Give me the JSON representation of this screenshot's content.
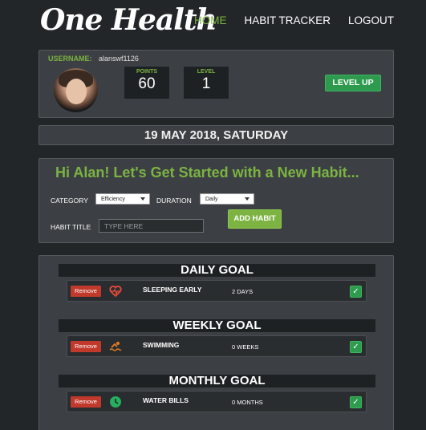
{
  "header": {
    "logo": "One Health",
    "nav": [
      {
        "label": "HOME",
        "active": true
      },
      {
        "label": "HABIT TRACKER",
        "active": false
      },
      {
        "label": "LOGOUT",
        "active": false
      }
    ]
  },
  "profile": {
    "username_label": "USERNAME:",
    "username": "alanswf1126",
    "points_label": "POINTS",
    "points": "60",
    "level_label": "LEVEL",
    "level": "1",
    "level_up_label": "LEVEL UP"
  },
  "date": "19 MAY 2018, SATURDAY",
  "new_habit": {
    "title": "Hi Alan! Let's Get Started with a New Habit...",
    "category_label": "CATEGORY",
    "category_value": "Efficiency",
    "duration_label": "DURATION",
    "duration_value": "Daily",
    "habit_title_label": "HABIT TITLE",
    "habit_title_placeholder": "TYPE HERE",
    "add_button": "ADD HABIT"
  },
  "goals": [
    {
      "heading": "DAILY GOAL",
      "item": {
        "remove": "Remove",
        "icon": "heartbeat-icon",
        "title": "SLEEPING EARLY",
        "count": "2 DAYS",
        "check": "✓"
      }
    },
    {
      "heading": "WEEKLY GOAL",
      "item": {
        "remove": "Remove",
        "icon": "swimmer-icon",
        "title": "SWIMMING",
        "count": "0 WEEKS",
        "check": "✓"
      }
    },
    {
      "heading": "MONTHLY GOAL",
      "item": {
        "remove": "Remove",
        "icon": "clock-icon",
        "title": "WATER BILLS",
        "count": "0 MONTHS",
        "check": "✓"
      }
    }
  ],
  "colors": {
    "accent": "#7cb342",
    "success": "#2e9a4e",
    "danger": "#c0392b"
  }
}
